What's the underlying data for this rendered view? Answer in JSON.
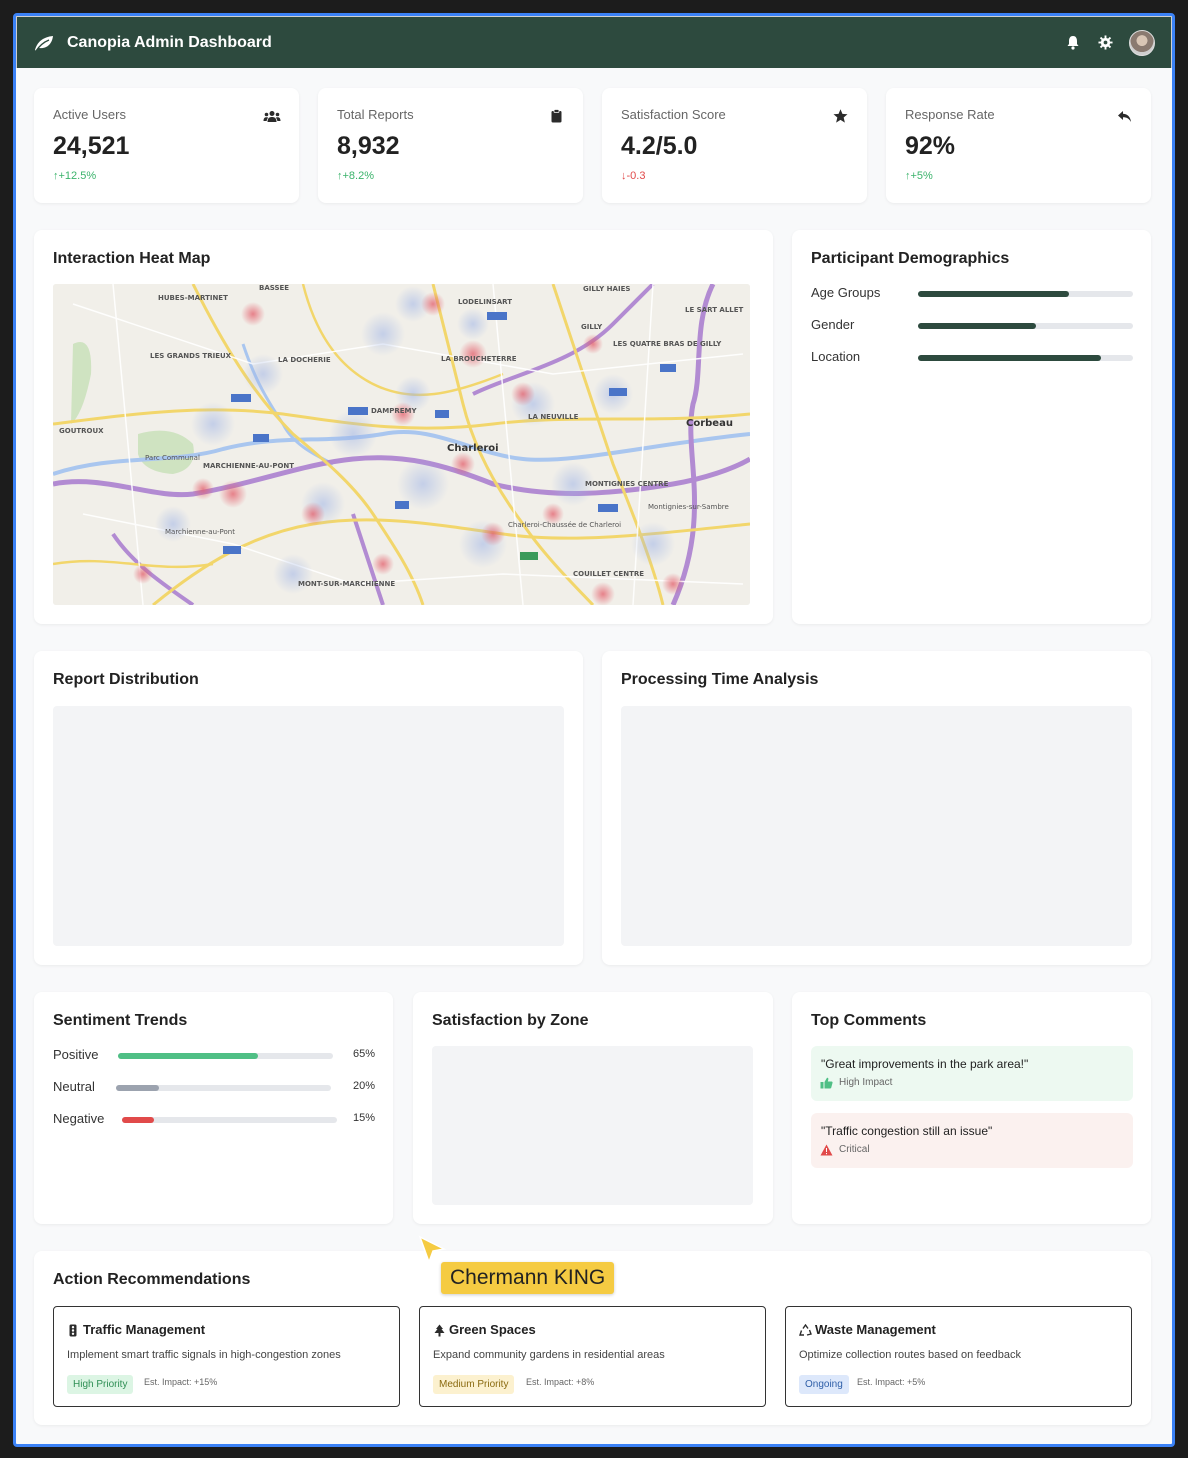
{
  "app": {
    "title": "Canopia Admin Dashboard"
  },
  "stats": [
    {
      "label": "Active Users",
      "value": "24,521",
      "delta": "+12.5%",
      "direction": "up",
      "icon": "users-icon"
    },
    {
      "label": "Total Reports",
      "value": "8,932",
      "delta": "+8.2%",
      "direction": "up",
      "icon": "clipboard-icon"
    },
    {
      "label": "Satisfaction Score",
      "value": "4.2/5.0",
      "delta": "-0.3",
      "direction": "down",
      "icon": "star-icon"
    },
    {
      "label": "Response Rate",
      "value": "92%",
      "delta": "+5%",
      "direction": "up",
      "icon": "reply-icon"
    }
  ],
  "heatmap": {
    "title": "Interaction Heat Map",
    "labels": [
      "BASSEE",
      "HUBES-MARTINET",
      "LODELINSART",
      "GILLY HAIES",
      "LE SART ALLET",
      "GILLY",
      "LES QUATRE BRAS DE GILLY",
      "LES GRANDS TRIEUX",
      "LA DOCHERIE",
      "LA BROUCHETERRE",
      "Corbeau",
      "LA NEUVILLE",
      "DAMPREMY",
      "GOUTROUX",
      "Charleroi",
      "Parc Communal",
      "MARCHIENNE-AU-PONT",
      "MONTIGNIES CENTRE",
      "Montignies-sur-Sambre",
      "Marchienne-au-Pont",
      "Charleroi-Chaussée de Charleroi",
      "COUILLET CENTRE",
      "MONT-SUR-MARCHIENNE"
    ]
  },
  "demographics": {
    "title": "Participant Demographics",
    "rows": [
      {
        "label": "Age Groups",
        "fraction": 0.7
      },
      {
        "label": "Gender",
        "fraction": 0.55
      },
      {
        "label": "Location",
        "fraction": 0.85
      }
    ]
  },
  "report_distribution": {
    "title": "Report Distribution"
  },
  "processing_time": {
    "title": "Processing Time Analysis"
  },
  "sentiment": {
    "title": "Sentiment Trends",
    "rows": [
      {
        "label": "Positive",
        "pct": "65%",
        "fraction": 0.65,
        "color": "#4fbf85"
      },
      {
        "label": "Neutral",
        "pct": "20%",
        "fraction": 0.2,
        "color": "#9ca3af"
      },
      {
        "label": "Negative",
        "pct": "15%",
        "fraction": 0.15,
        "color": "#e14a4a"
      }
    ]
  },
  "zone": {
    "title": "Satisfaction by Zone"
  },
  "comments": {
    "title": "Top Comments",
    "items": [
      {
        "text": "\"Great improvements in the park area!\"",
        "tag": "High Impact",
        "bg": "#edf9f1",
        "icon": "thumbs-up-icon"
      },
      {
        "text": "\"Traffic congestion still an issue\"",
        "tag": "Critical",
        "bg": "#fbf1ef",
        "icon": "warning-icon"
      }
    ]
  },
  "actions": {
    "title": "Action Recommendations",
    "items": [
      {
        "title": "Traffic Management",
        "desc": "Implement smart traffic signals in high-congestion zones",
        "badge": "High Priority",
        "badge_bg": "#dcf5e4",
        "badge_color": "#2f8f55",
        "impact": "Est. Impact: +15%",
        "icon": "traffic-light-icon"
      },
      {
        "title": "Green Spaces",
        "desc": "Expand community gardens in residential areas",
        "badge": "Medium Priority",
        "badge_bg": "#fcf1cf",
        "badge_color": "#8a6a10",
        "impact": "Est. Impact: +8%",
        "icon": "tree-icon"
      },
      {
        "title": "Waste Management",
        "desc": "Optimize collection routes based on feedback",
        "badge": "Ongoing",
        "badge_bg": "#dde8fb",
        "badge_color": "#2f5fa8",
        "impact": "Est. Impact: +5%",
        "icon": "recycle-icon"
      }
    ]
  },
  "cursor_label": "Chermann KING"
}
